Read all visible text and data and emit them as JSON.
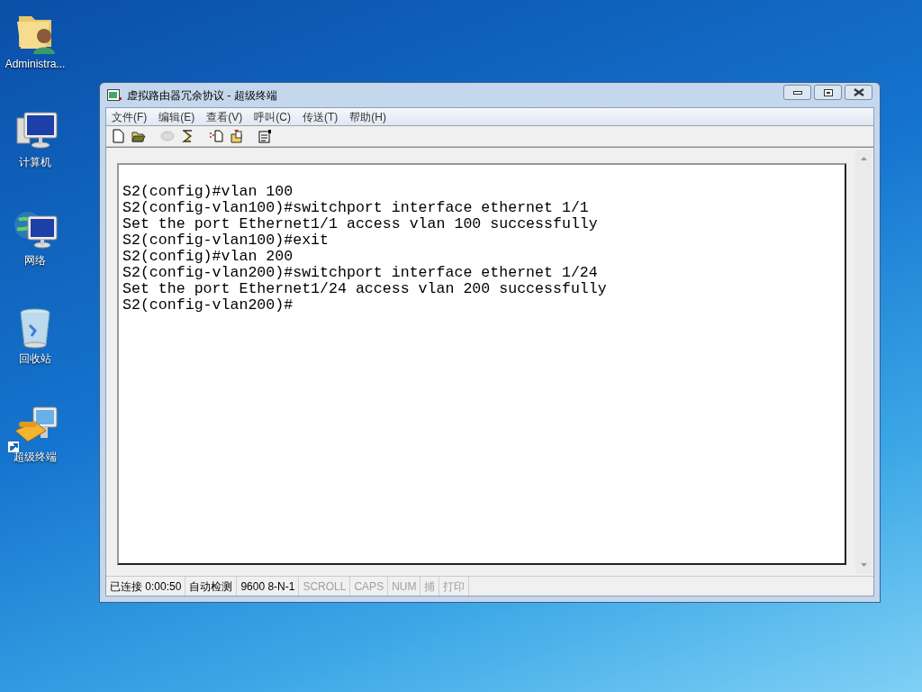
{
  "desktop_icons": [
    {
      "kind": "user-folder",
      "label": "Administra..."
    },
    {
      "kind": "computer",
      "label": "计算机"
    },
    {
      "kind": "network",
      "label": "网络"
    },
    {
      "kind": "recycle-bin",
      "label": "回收站"
    },
    {
      "kind": "terminal",
      "label": "超级终端",
      "shortcut": true
    }
  ],
  "window": {
    "title": "虚拟路由器冗余协议 - 超级终端"
  },
  "menu": [
    "文件(F)",
    "编辑(E)",
    "查看(V)",
    "呼叫(C)",
    "传送(T)",
    "帮助(H)"
  ],
  "toolbar": [
    {
      "buttons": [
        {
          "kind": "new",
          "disabled": false
        },
        {
          "kind": "open",
          "disabled": false
        }
      ]
    },
    {
      "buttons": [
        {
          "kind": "phone",
          "disabled": true
        },
        {
          "kind": "dial",
          "disabled": false
        }
      ]
    },
    {
      "buttons": [
        {
          "kind": "send",
          "disabled": false
        },
        {
          "kind": "receive",
          "disabled": false
        }
      ]
    },
    {
      "buttons": [
        {
          "kind": "properties",
          "disabled": false
        }
      ]
    }
  ],
  "terminal_lines": [
    "S2(config)#vlan 100",
    "S2(config-vlan100)#switchport interface ethernet 1/1",
    "Set the port Ethernet1/1 access vlan 100 successfully",
    "S2(config-vlan100)#exit",
    "S2(config)#vlan 200",
    "S2(config-vlan200)#switchport interface ethernet 1/24",
    "Set the port Ethernet1/24 access vlan 200 successfully",
    "S2(config-vlan200)#"
  ],
  "status_bar": [
    {
      "text": "已连接 0:00:50",
      "disabled": false
    },
    {
      "text": "自动检测",
      "disabled": false
    },
    {
      "text": "9600 8-N-1",
      "disabled": false
    },
    {
      "text": "SCROLL",
      "disabled": true
    },
    {
      "text": "CAPS",
      "disabled": true
    },
    {
      "text": "NUM",
      "disabled": true
    },
    {
      "text": "捕",
      "disabled": true
    },
    {
      "text": "打印",
      "disabled": true
    }
  ]
}
